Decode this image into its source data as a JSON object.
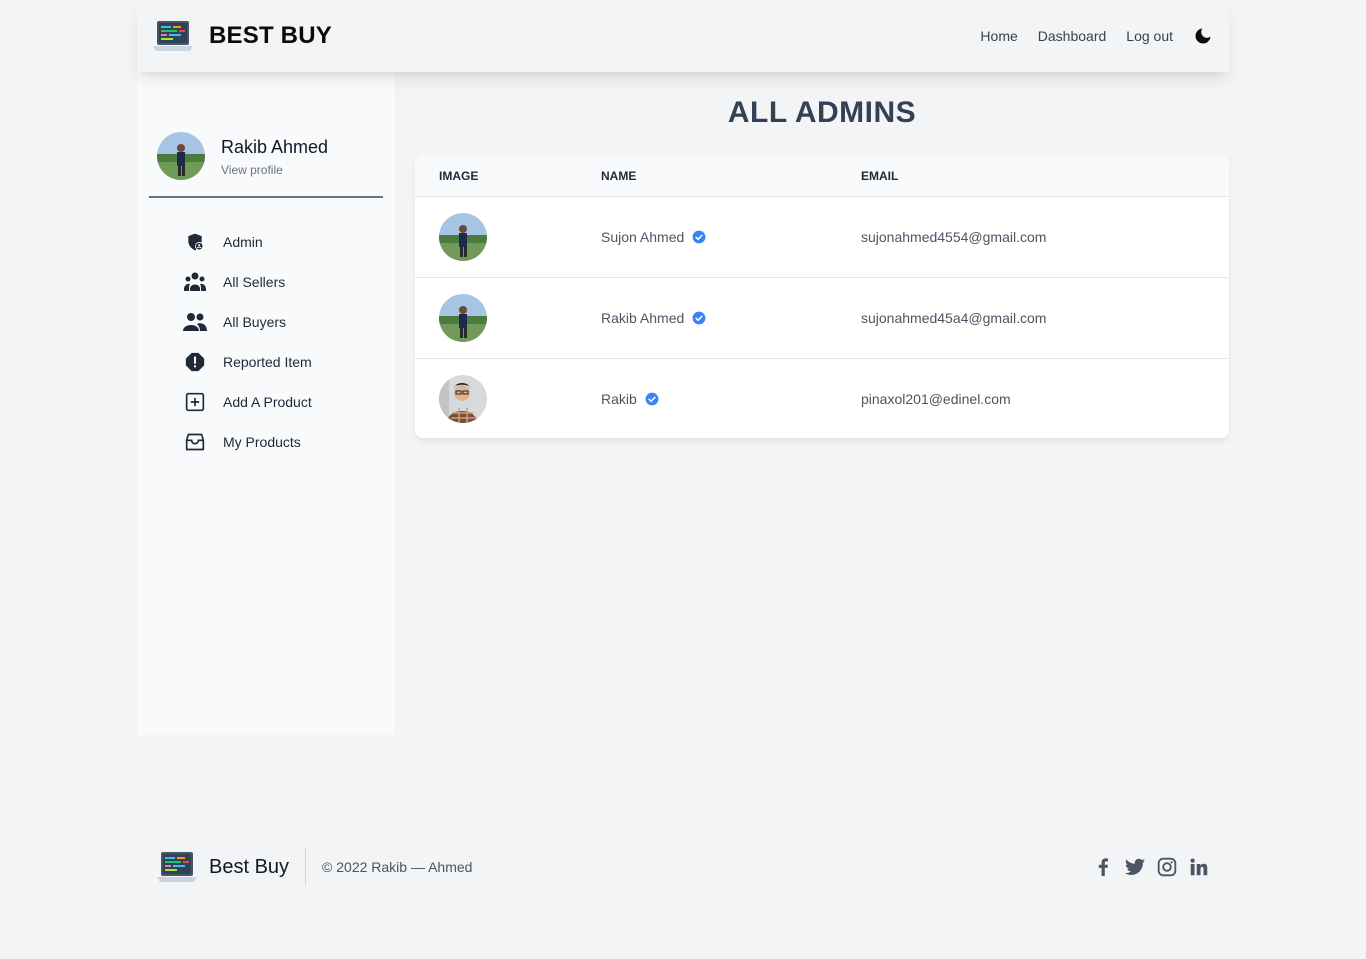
{
  "header": {
    "brand": "BEST BUY",
    "nav": [
      {
        "label": "Home"
      },
      {
        "label": "Dashboard"
      },
      {
        "label": "Log out"
      }
    ]
  },
  "sidebar": {
    "profile_name": "Rakib Ahmed",
    "profile_link": "View profile",
    "items": [
      {
        "label": "Admin",
        "icon": "shield-user-icon"
      },
      {
        "label": "All Sellers",
        "icon": "group-icon"
      },
      {
        "label": "All Buyers",
        "icon": "users-icon"
      },
      {
        "label": "Reported Item",
        "icon": "alert-icon"
      },
      {
        "label": "Add A Product",
        "icon": "plus-square-icon"
      },
      {
        "label": "My Products",
        "icon": "inbox-icon"
      }
    ]
  },
  "main": {
    "title": "ALL ADMINS",
    "columns": [
      "IMAGE",
      "NAME",
      "EMAIL"
    ],
    "rows": [
      {
        "name": "Sujon Ahmed",
        "email": "sujonahmed4554@gmail.com"
      },
      {
        "name": "Rakib Ahmed",
        "email": "sujonahmed45a4@gmail.com"
      },
      {
        "name": "Rakib",
        "email": "pinaxol201@edinel.com"
      }
    ]
  },
  "footer": {
    "brand": "Best Buy",
    "copyright": "© 2022 Rakib — Ahmed",
    "socials": [
      "facebook-icon",
      "twitter-icon",
      "instagram-icon",
      "linkedin-icon"
    ]
  },
  "colors": {
    "accent": "#3b82f6",
    "title": "#334155",
    "background": "#f3f4f6"
  }
}
